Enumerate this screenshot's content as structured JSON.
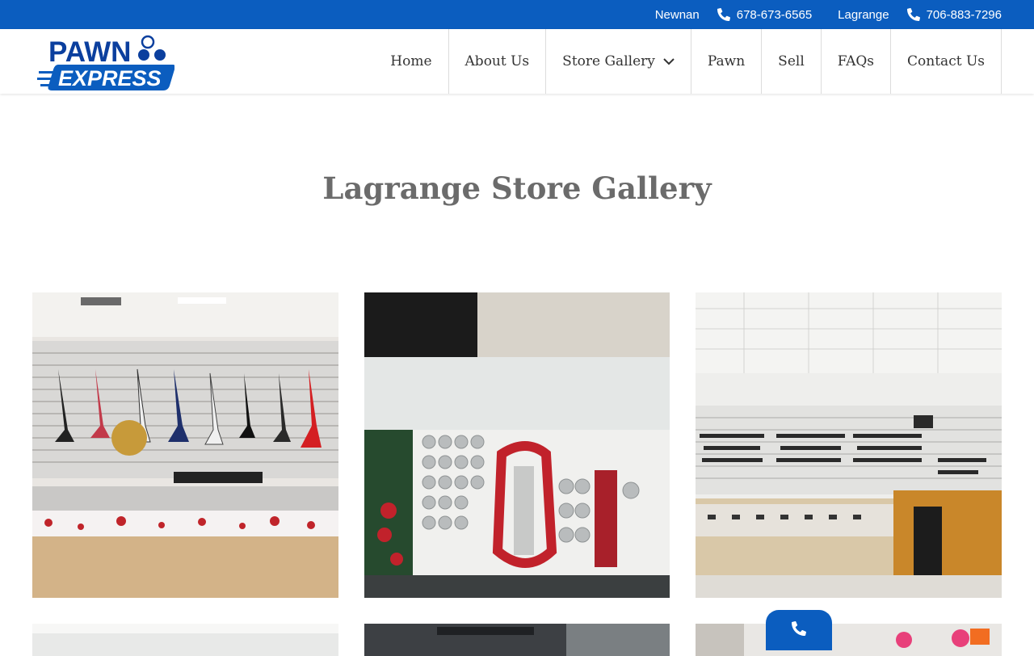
{
  "topbar": {
    "locations": [
      {
        "city": "Newnan",
        "phone": "678-673-6565"
      },
      {
        "city": "Lagrange",
        "phone": "706-883-7296"
      }
    ],
    "background": "#0b5dbf"
  },
  "logo": {
    "line1": "PAWN",
    "line2": "EXPRESS"
  },
  "nav": {
    "items": [
      {
        "label": "Home"
      },
      {
        "label": "About Us"
      },
      {
        "label": "Store Gallery",
        "has_dropdown": true
      },
      {
        "label": "Pawn"
      },
      {
        "label": "Sell"
      },
      {
        "label": "FAQs"
      },
      {
        "label": "Contact Us"
      }
    ]
  },
  "page": {
    "title": "Lagrange Store Gallery"
  },
  "gallery": {
    "photos": [
      {
        "subject": "guitars-and-jewelry-case"
      },
      {
        "subject": "coins-display-case"
      },
      {
        "subject": "firearms-wall-and-case"
      },
      {
        "subject": "store-photo-4"
      },
      {
        "subject": "store-photo-5"
      },
      {
        "subject": "store-photo-6"
      }
    ]
  },
  "colors": {
    "brand_blue": "#0b5dbf",
    "title_gray": "#6b6b6b",
    "nav_text": "#333333"
  },
  "icons": {
    "phone": "phone-icon",
    "dropdown": "chevron-down-icon"
  }
}
